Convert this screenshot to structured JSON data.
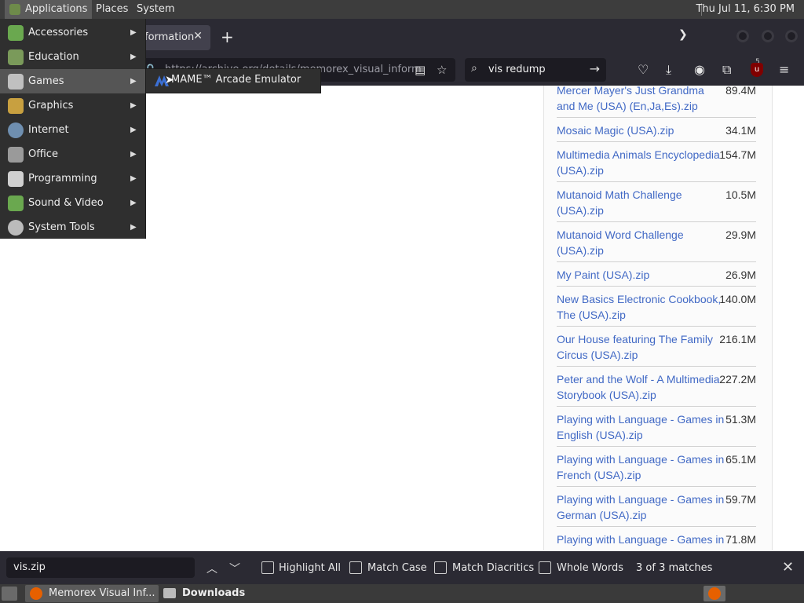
{
  "topbar": {
    "applications": "Applications",
    "places": "Places",
    "system": "System",
    "clock": "Thu Jul 11,  6:30 PM"
  },
  "browser": {
    "tab_title": "formation",
    "url": "https://archive.org/details/memorex_visual_inform",
    "search_query": "vis redump",
    "extension_badge": "5"
  },
  "files": [
    {
      "name": "Mercer Mayer's Just Grandma and Me (USA) (En,Ja,Es).zip",
      "size": "89.4M"
    },
    {
      "name": "Mosaic Magic (USA).zip",
      "size": "34.1M"
    },
    {
      "name": "Multimedia Animals Encyclopedia (USA).zip",
      "size": "154.7M"
    },
    {
      "name": "Mutanoid Math Challenge (USA).zip",
      "size": "10.5M"
    },
    {
      "name": "Mutanoid Word Challenge (USA).zip",
      "size": "29.9M"
    },
    {
      "name": "My Paint (USA).zip",
      "size": "26.9M"
    },
    {
      "name": "New Basics Electronic Cookbook, The (USA).zip",
      "size": "140.0M"
    },
    {
      "name": "Our House featuring The Family Circus (USA).zip",
      "size": "216.1M"
    },
    {
      "name": "Peter and the Wolf - A Multimedia Storybook (USA).zip",
      "size": "227.2M"
    },
    {
      "name": "Playing with Language - Games in English (USA).zip",
      "size": "51.3M"
    },
    {
      "name": "Playing with Language - Games in French (USA).zip",
      "size": "65.1M"
    },
    {
      "name": "Playing with Language - Games in German (USA).zip",
      "size": "59.7M"
    },
    {
      "name": "Playing with Language - Games in Italian (USA).zip",
      "size": "71.8M"
    }
  ],
  "app_menu": {
    "items": [
      {
        "label": "Accessories",
        "icon": "accessories-icon",
        "color": "#6aa84f"
      },
      {
        "label": "Education",
        "icon": "education-icon",
        "color": "#7a9a5a"
      },
      {
        "label": "Games",
        "icon": "games-icon",
        "color": "#c0c0c0"
      },
      {
        "label": "Graphics",
        "icon": "graphics-icon",
        "color": "#c8a040"
      },
      {
        "label": "Internet",
        "icon": "internet-icon",
        "color": "#6f8fb0"
      },
      {
        "label": "Office",
        "icon": "office-icon",
        "color": "#9a9a9a"
      },
      {
        "label": "Programming",
        "icon": "programming-icon",
        "color": "#d0d0d0"
      },
      {
        "label": "Sound & Video",
        "icon": "sound-video-icon",
        "color": "#6aa84f"
      },
      {
        "label": "System Tools",
        "icon": "system-tools-icon",
        "color": "#bbbbbb"
      }
    ],
    "games_submenu": [
      "MAME™ Arcade Emulator"
    ]
  },
  "find_bar": {
    "value": "vis.zip",
    "highlight_all": "Highlight All",
    "match_case": "Match Case",
    "match_diacritics": "Match Diacritics",
    "whole_words": "Whole Words",
    "matches": "3 of 3 matches"
  },
  "taskbar": {
    "task1": "Memorex Visual Inf...",
    "task2": "Downloads"
  }
}
